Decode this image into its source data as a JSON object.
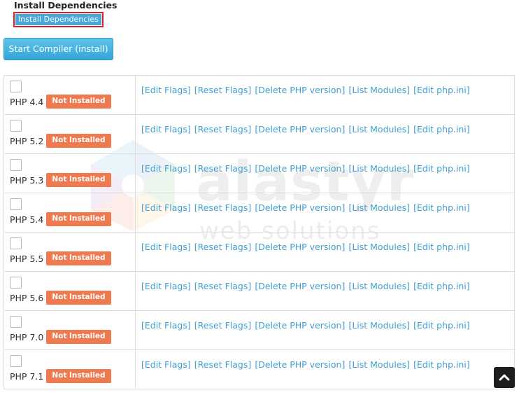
{
  "header": {
    "title": "Install Dependencies",
    "dependencies_button": "Install Dependencies",
    "compile_button": "Start Compiler (install)"
  },
  "watermark": {
    "brand": "alastyr",
    "tagline": "web solutions"
  },
  "actions": {
    "edit_flags": "[Edit Flags]",
    "reset_flags": "[Reset Flags]",
    "delete_php": "[Delete PHP version]",
    "list_modules": "[List Modules]",
    "edit_ini": "[Edit php.ini]"
  },
  "rows": [
    {
      "version": "PHP 4.4",
      "status": "Not Installed",
      "checked": false
    },
    {
      "version": "PHP 5.2",
      "status": "Not Installed",
      "checked": false
    },
    {
      "version": "PHP 5.3",
      "status": "Not Installed",
      "checked": false
    },
    {
      "version": "PHP 5.4",
      "status": "Not Installed",
      "checked": false
    },
    {
      "version": "PHP 5.5",
      "status": "Not Installed",
      "checked": false
    },
    {
      "version": "PHP 5.6",
      "status": "Not Installed",
      "checked": false
    },
    {
      "version": "PHP 7.0",
      "status": "Not Installed",
      "checked": false
    },
    {
      "version": "PHP 7.1",
      "status": "Not Installed",
      "checked": false
    }
  ],
  "scroll_top_icon": "chevron-up-icon",
  "colors": {
    "link": "#3fa0d0",
    "badge": "#ef7a4f",
    "button": "#4aa8d8",
    "highlight": "#d9202a"
  }
}
